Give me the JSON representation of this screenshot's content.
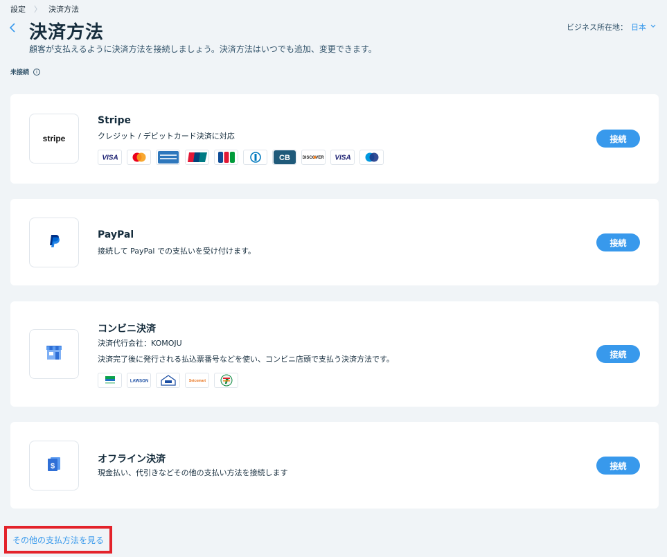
{
  "breadcrumb": {
    "parent": "設定",
    "separator": "〉",
    "current": "決済方法"
  },
  "header": {
    "title": "決済方法",
    "subtitle": "顧客が支払えるように決済方法を接続しましょう。決済方法はいつでも追加、変更できます。",
    "business_location_label": "ビジネス所在地：",
    "business_location_value": "日本"
  },
  "section": {
    "label": "未接続",
    "info_icon": "info-icon"
  },
  "methods": [
    {
      "title": "Stripe",
      "description": "クレジット / デビットカード決済に対応",
      "logo_text": "stripe",
      "button": "接続",
      "card_badges": [
        "VISA",
        "Mastercard",
        "American Express",
        "UnionPay",
        "JCB",
        "Diners Club",
        "CB",
        "DISCOVER",
        "VISA",
        "Maestro"
      ]
    },
    {
      "title": "PayPal",
      "description": "接続して PayPal での支払いを受け付けます。",
      "logo_icon": "paypal-icon",
      "button": "接続"
    },
    {
      "title": "コンビニ決済",
      "description_provider": "決済代行会社：KOMOJU",
      "description": "決済完了後に発行される払込票番号などを使い、コンビニ店頭で支払う決済方法です。",
      "logo_icon": "store-icon",
      "button": "接続",
      "store_badges": [
        "FamilyMart",
        "LAWSON",
        "MINISTOP",
        "Seicomart",
        "7-Eleven"
      ]
    },
    {
      "title": "オフライン決済",
      "description": "現金払い、代引きなどその他の支払い方法を接続します",
      "logo_icon": "cash-icon",
      "button": "接続"
    }
  ],
  "footer": {
    "more_link": "その他の支払方法を見る"
  },
  "colors": {
    "accent": "#3899ec",
    "highlight": "#e3222a",
    "background": "#f0f4f7"
  }
}
